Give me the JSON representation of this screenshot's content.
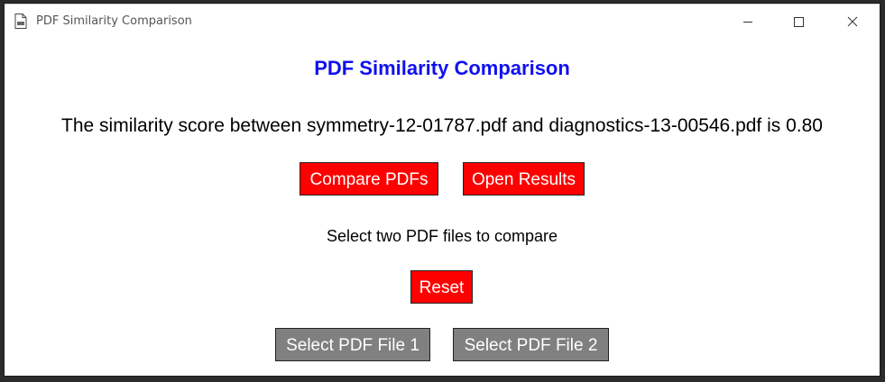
{
  "window": {
    "title": "PDF Similarity Comparison",
    "controls": {
      "minimize": "minimize-icon",
      "maximize": "maximize-icon",
      "close": "close-icon"
    }
  },
  "main": {
    "heading": "PDF Similarity Comparison",
    "result_text": "The similarity score between symmetry-12-01787.pdf and diagnostics-13-00546.pdf is 0.80",
    "status_text": "Select two PDF files to compare"
  },
  "buttons": {
    "compare": "Compare PDFs",
    "open_results": "Open Results",
    "reset": "Reset",
    "select_file_1": "Select PDF File 1",
    "select_file_2": "Select PDF File 2"
  },
  "colors": {
    "heading": "#1010ee",
    "action_button": "#ff0000",
    "select_button": "#808080",
    "button_text": "#ffffff"
  }
}
